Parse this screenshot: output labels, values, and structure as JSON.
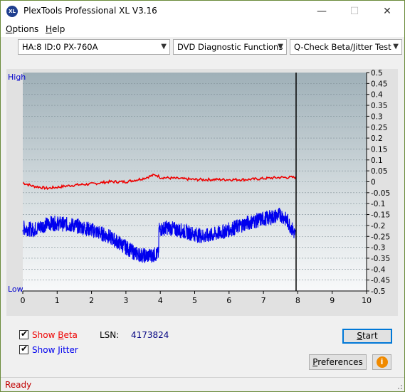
{
  "app": {
    "title": "PlexTools Professional XL V3.16",
    "icon_text": "XL"
  },
  "window_controls": {
    "minimize": "—",
    "maximize": "☐",
    "close": "✕"
  },
  "menu": {
    "options": "ptions",
    "options_mnemonic": "O",
    "help": "elp",
    "help_mnemonic": "H"
  },
  "toolbar": {
    "drive": "HA:8 ID:0  PX-760A",
    "function": "DVD Diagnostic Functions",
    "test": "Q-Check Beta/Jitter Test"
  },
  "chart_labels": {
    "high": "High",
    "low": "Low"
  },
  "chart_data": {
    "type": "line",
    "x_ticks": [
      "0",
      "1",
      "2",
      "3",
      "4",
      "5",
      "6",
      "7",
      "8",
      "9",
      "10"
    ],
    "xlim": [
      0,
      10
    ],
    "y_ticks": [
      "0.5",
      "0.45",
      "0.4",
      "0.35",
      "0.3",
      "0.25",
      "0.2",
      "0.15",
      "0.1",
      "0.05",
      "0",
      "-0.05",
      "-0.1",
      "-0.15",
      "-0.2",
      "-0.25",
      "-0.3",
      "-0.35",
      "-0.4",
      "-0.45",
      "-0.5"
    ],
    "ylim": [
      -0.5,
      0.5
    ],
    "grid": true,
    "progress_marker_x": 7.95,
    "series": [
      {
        "color": "#ee0000",
        "x": [
          0,
          0.3,
          0.7,
          1.0,
          1.5,
          2.0,
          2.5,
          3.0,
          3.5,
          3.8,
          3.9,
          4.0,
          4.5,
          5.0,
          5.5,
          6.0,
          6.5,
          7.0,
          7.5,
          7.95
        ],
        "values": [
          -0.005,
          -0.02,
          -0.03,
          -0.025,
          -0.015,
          -0.01,
          0.0,
          0.0,
          0.015,
          0.03,
          0.03,
          0.02,
          0.015,
          0.01,
          0.01,
          0.01,
          0.01,
          0.015,
          0.02,
          0.02
        ]
      },
      {
        "color": "#0000ee",
        "x": [
          0,
          0.3,
          0.6,
          0.8,
          1.0,
          1.5,
          2.0,
          2.5,
          3.0,
          3.3,
          3.6,
          3.95,
          3.96,
          4.2,
          4.5,
          5.0,
          5.3,
          5.6,
          6.0,
          6.5,
          7.0,
          7.3,
          7.5,
          7.7,
          7.95
        ],
        "values": [
          -0.21,
          -0.22,
          -0.2,
          -0.19,
          -0.19,
          -0.2,
          -0.22,
          -0.25,
          -0.3,
          -0.33,
          -0.34,
          -0.33,
          -0.22,
          -0.21,
          -0.22,
          -0.24,
          -0.25,
          -0.24,
          -0.22,
          -0.19,
          -0.17,
          -0.16,
          -0.15,
          -0.18,
          -0.25
        ]
      }
    ]
  },
  "options": {
    "show_beta": "Show ",
    "show_beta_underlined": "B",
    "show_beta_rest": "eta",
    "show_beta_checked": "✔",
    "show_beta_color": "#ee0000",
    "show_jitter": "Show ",
    "show_jitter_underlined": "J",
    "show_jitter_rest": "itter",
    "show_jitter_checked": "✔",
    "show_jitter_color": "#0000ee"
  },
  "lsn": {
    "label": "LSN:",
    "value": "4173824"
  },
  "buttons": {
    "start_mnemonic": "S",
    "start_rest": "tart",
    "preferences_mnemonic": "P",
    "preferences_rest": "references",
    "info_icon": "i"
  },
  "status": {
    "text": "Ready"
  }
}
